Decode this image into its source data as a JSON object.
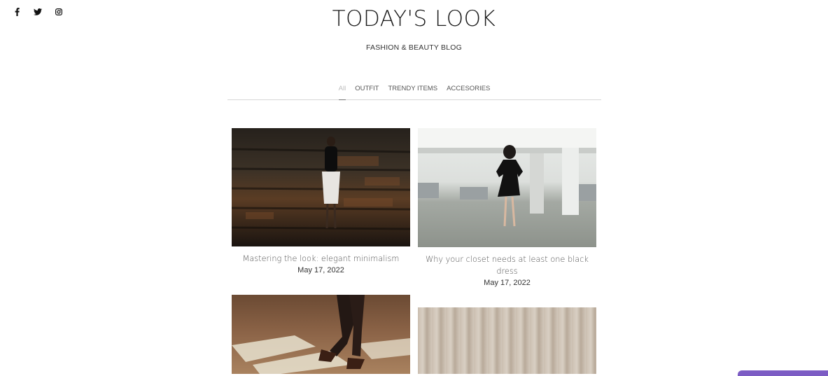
{
  "social": [
    {
      "name": "facebook-icon"
    },
    {
      "name": "twitter-icon"
    },
    {
      "name": "instagram-icon"
    }
  ],
  "header": {
    "title": "TODAY'S LOOK",
    "tagline": "FASHION & BEAUTY BLOG"
  },
  "filters": [
    {
      "label": "All",
      "active": true
    },
    {
      "label": "OUTFIT",
      "active": false
    },
    {
      "label": "TRENDY ITEMS",
      "active": false
    },
    {
      "label": "ACCESORIES",
      "active": false
    }
  ],
  "posts": [
    {
      "title": "Mastering the look: elegant minimalism",
      "date": "May 17, 2022"
    },
    {
      "title": "Why your closet needs at least one black dress",
      "date": "May 17, 2022"
    },
    {
      "title": "",
      "date": ""
    },
    {
      "title": "",
      "date": ""
    }
  ],
  "colors": {
    "chat_tab": "#7c5cc4",
    "divider": "#d7d7d7"
  }
}
